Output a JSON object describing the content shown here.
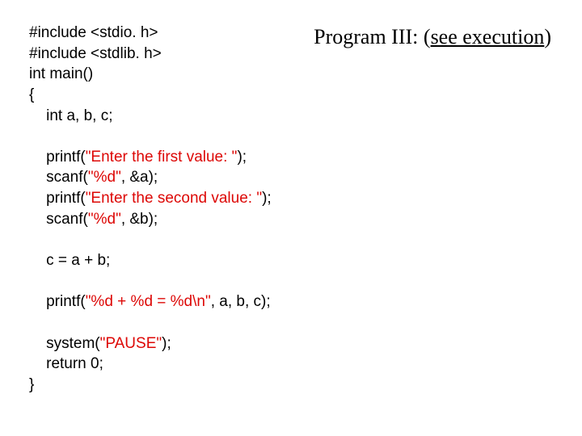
{
  "heading": {
    "label": "Program III:",
    "paren_open": "(",
    "link_text": "see execution",
    "paren_close": ")"
  },
  "code": {
    "l01": "#include <stdio. h>",
    "l02": "#include <stdlib. h>",
    "l03": "int main()",
    "l04": "{",
    "l05": "    int a, b, c;",
    "l06": "",
    "l07a": "    printf(",
    "l07b": "\"Enter the first value: \"",
    "l07c": ");",
    "l08a": "    scanf(",
    "l08b": "\"%d\"",
    "l08c": ", &a);",
    "l09a": "    printf(",
    "l09b": "\"Enter the second value: \"",
    "l09c": ");",
    "l10a": "    scanf(",
    "l10b": "\"%d\"",
    "l10c": ", &b);",
    "l11": "",
    "l12": "    c = a + b;",
    "l13": "",
    "l14a": "    printf(",
    "l14b": "\"%d + %d = %d\\n\"",
    "l14c": ", a, b, c);",
    "l15": "",
    "l16a": "    system(",
    "l16b": "\"PAUSE\"",
    "l16c": ");",
    "l17": "    return 0;",
    "l18": "}"
  }
}
